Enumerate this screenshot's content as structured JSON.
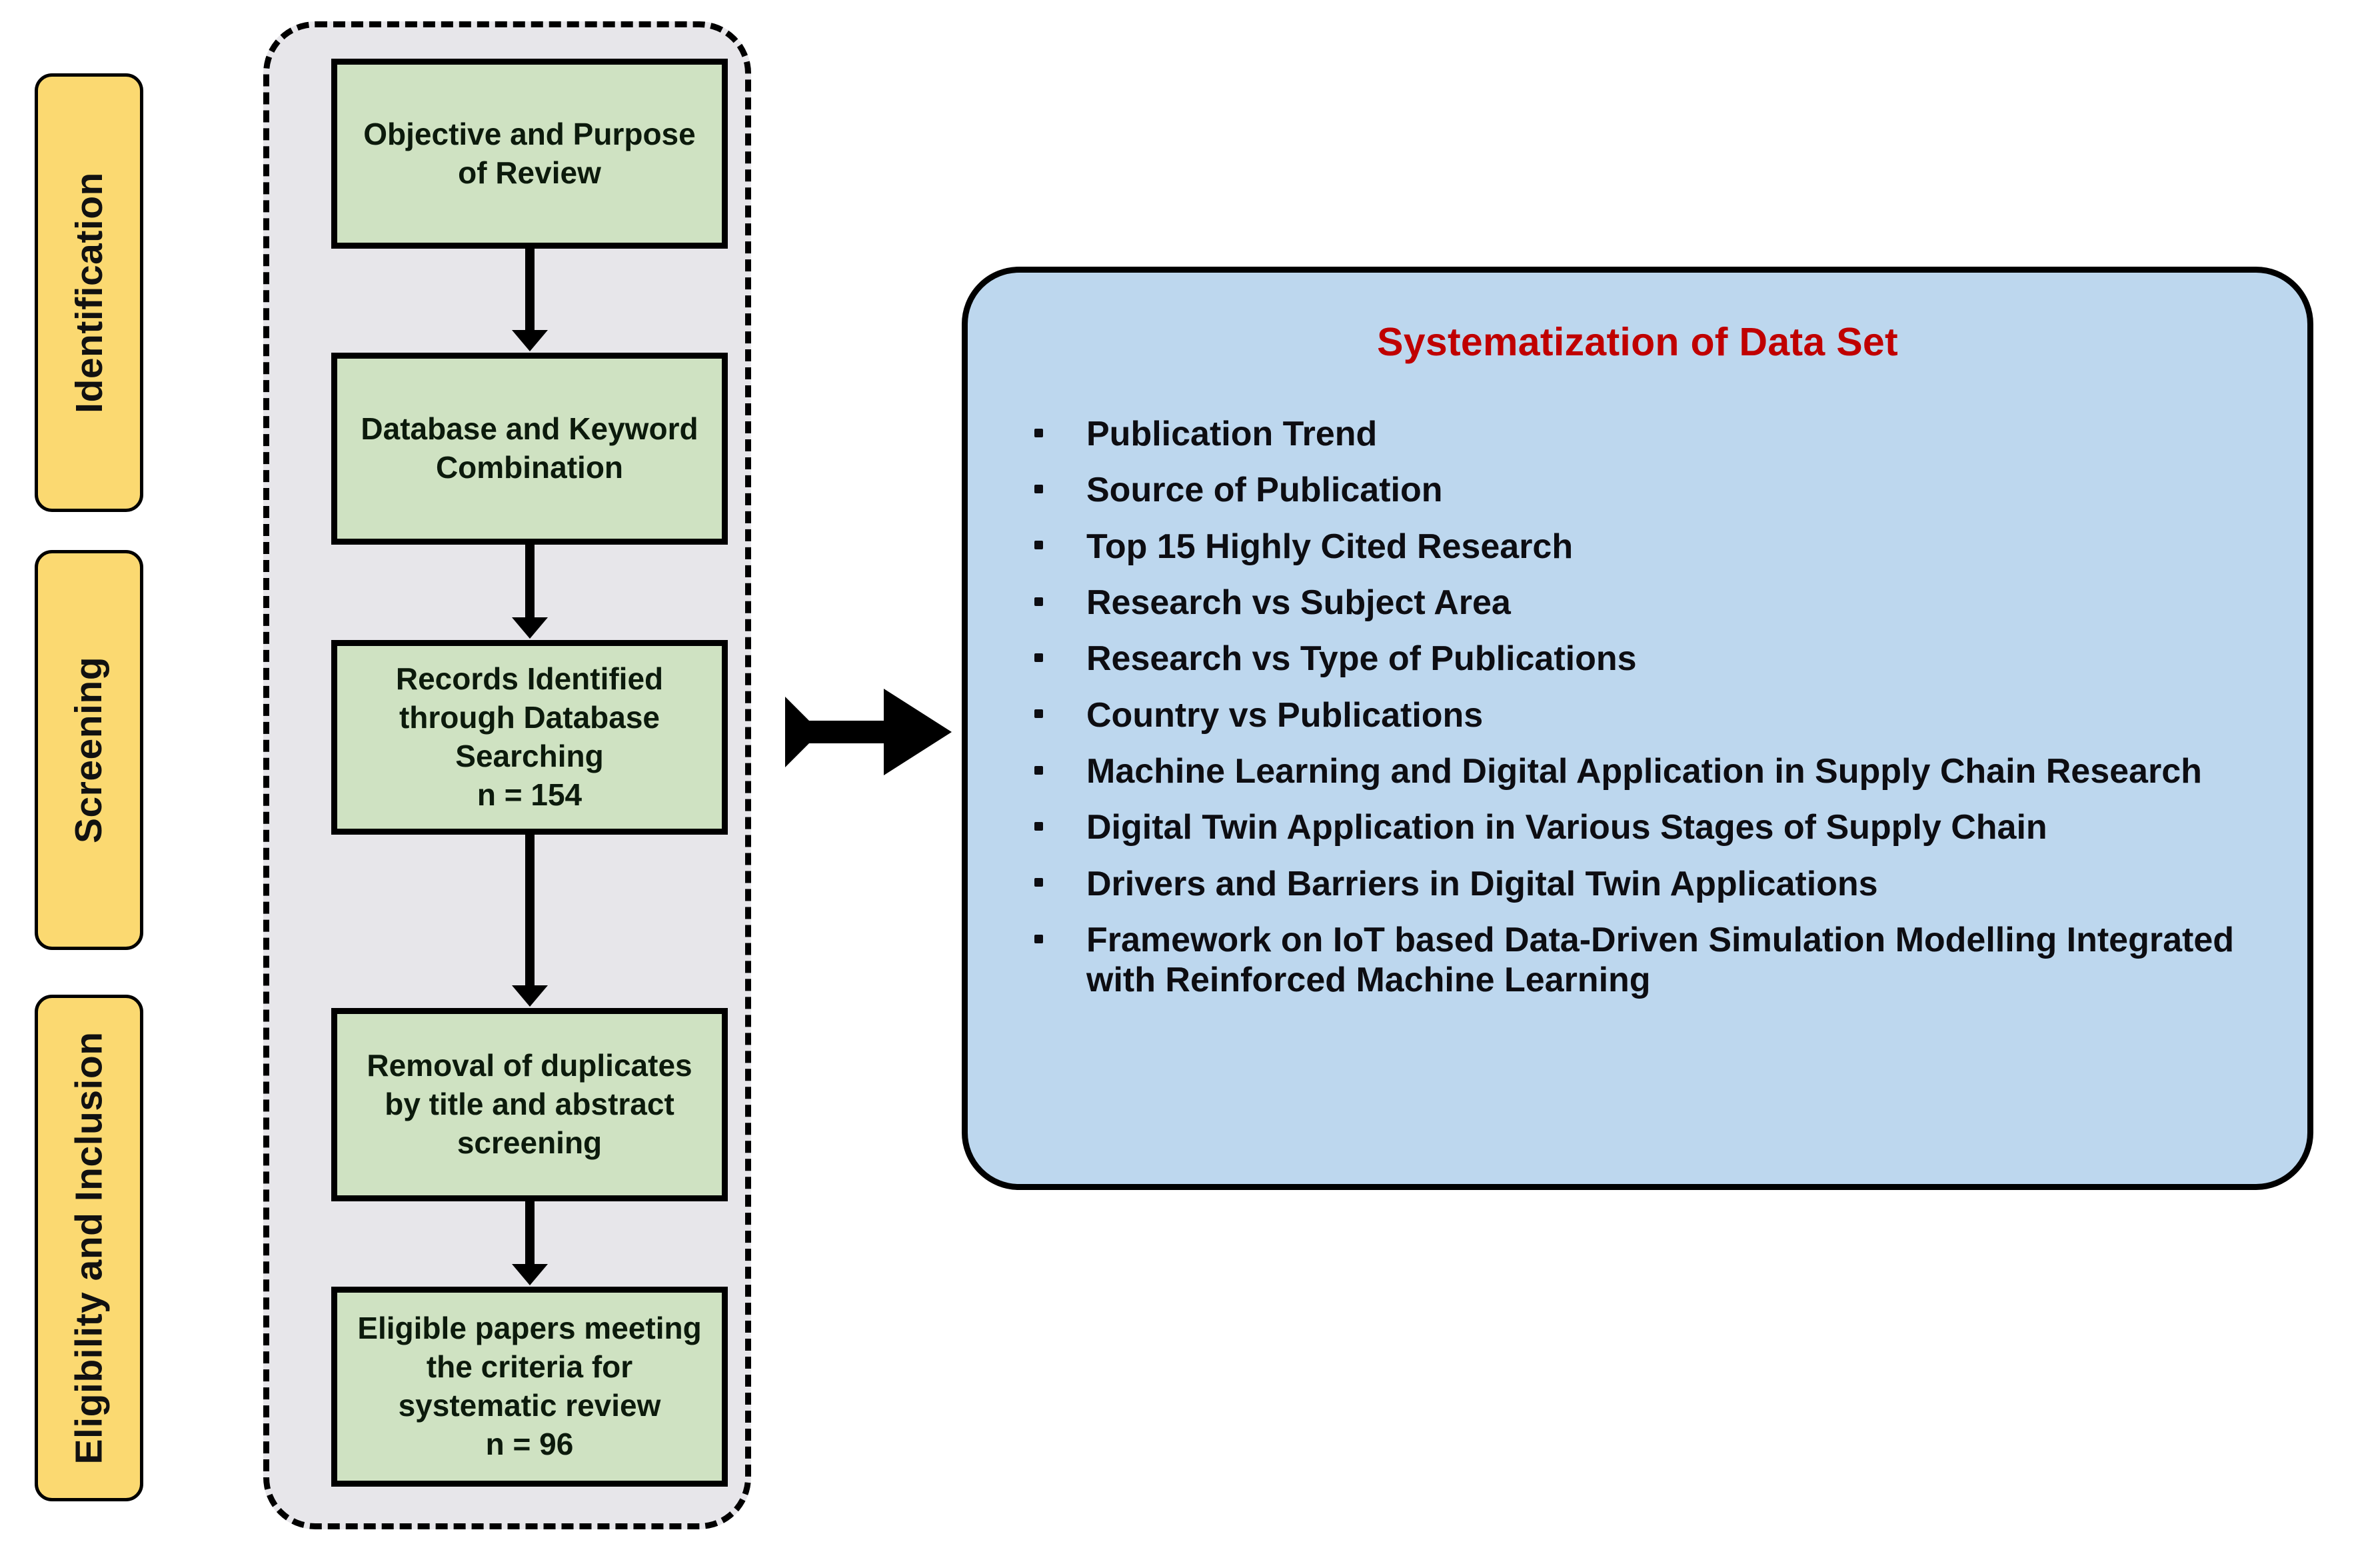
{
  "figure": {
    "type": "prisma-flow-diagram",
    "phases": [
      {
        "label": "Identification"
      },
      {
        "label": "Screening"
      },
      {
        "label": "Eligibility and Inclusion"
      }
    ],
    "flow_steps": [
      {
        "text": "Objective and Purpose of Review"
      },
      {
        "text": "Database and Keyword Combination"
      },
      {
        "text": "Records Identified through Database Searching\nn = 154"
      },
      {
        "text": "Removal of duplicates by title and abstract screening"
      },
      {
        "text": "Eligible papers meeting the criteria for systematic review\nn = 96"
      }
    ],
    "counts": {
      "records_identified": "n = 154",
      "eligible_papers": "n = 96"
    },
    "panel": {
      "title": "Systematization of Data Set",
      "items": [
        "Publication Trend",
        "Source of Publication",
        "Top 15 Highly Cited Research",
        "Research vs Subject Area",
        "Research vs Type of Publications",
        "Country vs Publications",
        "Machine Learning and Digital Application in Supply Chain Research",
        "Digital Twin Application in Various Stages of Supply Chain",
        "Drivers and Barriers in Digital Twin Applications",
        "Framework on IoT based Data-Driven Simulation Modelling Integrated with Reinforced Machine Learning"
      ]
    },
    "colors": {
      "phase_fill": "#fbd971",
      "step_fill": "#cfe2c2",
      "container_fill": "#e7e6ea",
      "panel_fill": "#bdd7ee",
      "panel_title": "#c00000",
      "stroke": "#000000"
    }
  }
}
